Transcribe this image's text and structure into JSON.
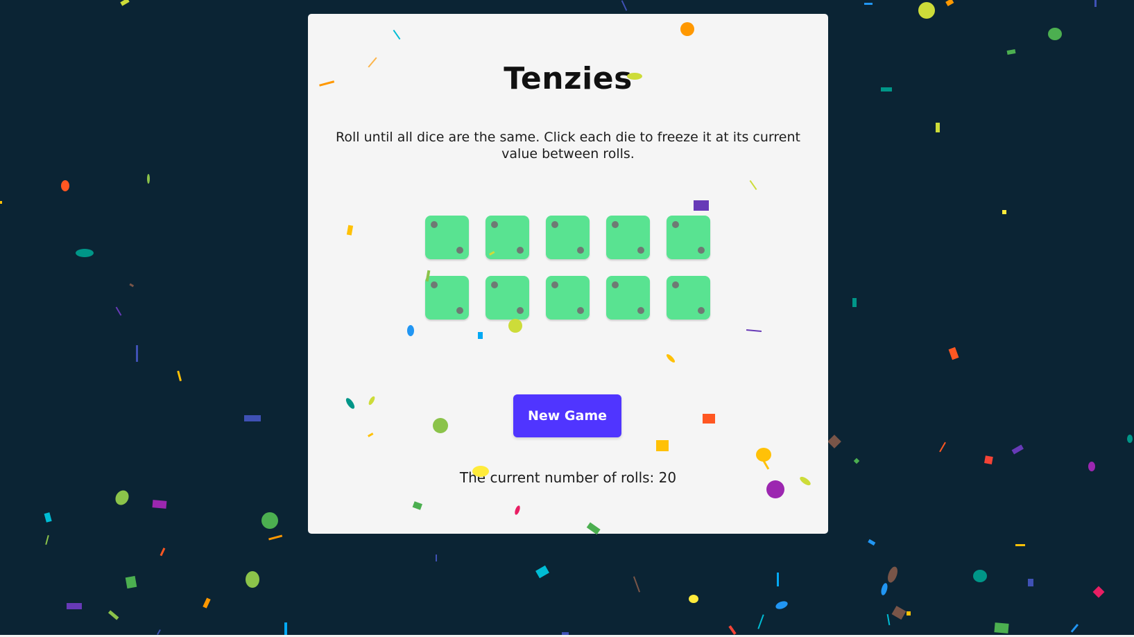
{
  "page": {
    "background_color": "#0B2434",
    "board_color": "#F5F5F5"
  },
  "game": {
    "title": "Tenzies",
    "instructions": "Roll until all dice are the same. Click each die to freeze it at its current value between rolls.",
    "dice": [
      {
        "value": 2,
        "held": false
      },
      {
        "value": 2,
        "held": false
      },
      {
        "value": 2,
        "held": false
      },
      {
        "value": 2,
        "held": false
      },
      {
        "value": 2,
        "held": false
      },
      {
        "value": 2,
        "held": false
      },
      {
        "value": 2,
        "held": false
      },
      {
        "value": 2,
        "held": false
      },
      {
        "value": 2,
        "held": false
      },
      {
        "value": 2,
        "held": false
      }
    ],
    "die_color": "#59E391",
    "pip_color": "#6f7a74",
    "new_game_label": "New Game",
    "button_color": "#5035FF",
    "rolls_text": "The current number of rolls: 20"
  },
  "confetti": {
    "colors": [
      "#f44336",
      "#e91e63",
      "#9c27b0",
      "#673ab7",
      "#3f51b5",
      "#2196f3",
      "#03a9f4",
      "#00bcd4",
      "#009688",
      "#4CAF50",
      "#8BC34A",
      "#CDDC39",
      "#FFEB3B",
      "#FFC107",
      "#FF9800",
      "#FF5722",
      "#795548"
    ]
  }
}
